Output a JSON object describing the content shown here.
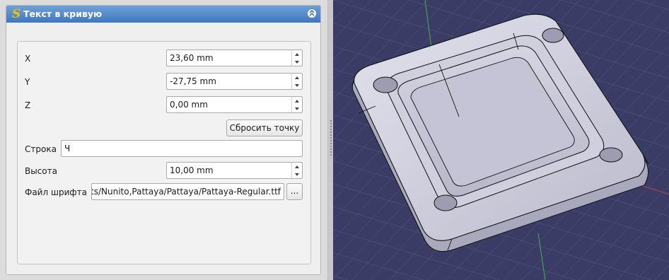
{
  "panel": {
    "title": "Текст в кривую",
    "title_icon": "shapestring-icon",
    "collapse_icon": "collapse-up-icon"
  },
  "fields": {
    "x": {
      "label": "X",
      "value": "23,60 mm"
    },
    "y": {
      "label": "Y",
      "value": "-27,75 mm"
    },
    "z": {
      "label": "Z",
      "value": "0,00 mm"
    },
    "reset_button": "Сбросить точку",
    "string": {
      "label": "Строка",
      "value": "Ч"
    },
    "height": {
      "label": "Высота",
      "value": "10,00 mm"
    },
    "font_file": {
      "label": "Файл шрифта",
      "value": "ts/Nunito,Pattaya/Pattaya/Pattaya-Regular.ttf",
      "browse_label": "..."
    }
  },
  "viewport": {
    "background": "#3b3c66",
    "grid_color": "#5a5c8a",
    "model_color": "#c7c7d6",
    "axis_x_color": "#b33b3b",
    "axis_y_color": "#3fb34a"
  }
}
